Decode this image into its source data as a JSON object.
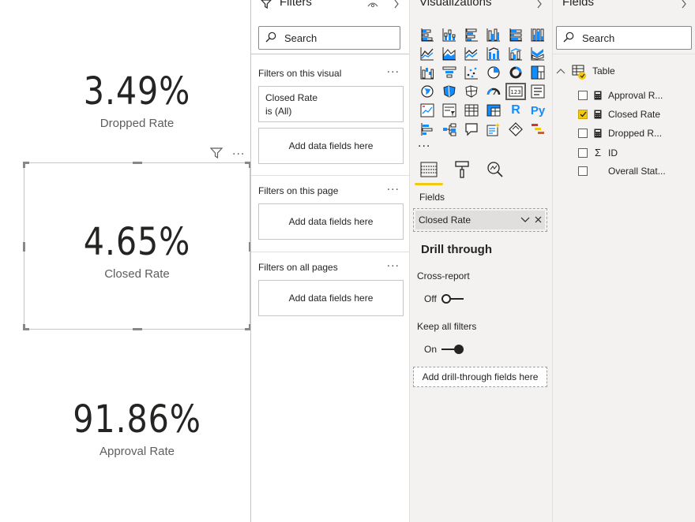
{
  "canvas": {
    "cards": [
      {
        "value": "3.49%",
        "label": "Dropped Rate"
      },
      {
        "value": "4.65%",
        "label": "Closed Rate"
      },
      {
        "value": "91.86%",
        "label": "Approval Rate"
      }
    ]
  },
  "filters": {
    "title": "Filters",
    "search_placeholder": "Search",
    "on_visual_label": "Filters on this visual",
    "visual_filter": {
      "field": "Closed Rate",
      "condition": "is (All)"
    },
    "add_fields": "Add data fields here",
    "on_page_label": "Filters on this page",
    "on_all_pages_label": "Filters on all pages"
  },
  "visualizations": {
    "title": "Visualizations",
    "more": "...",
    "fields_label": "Fields",
    "field_pill": "Closed Rate",
    "drill_title": "Drill through",
    "cross_report_label": "Cross-report",
    "cross_report_state": "Off",
    "keep_filters_label": "Keep all filters",
    "keep_filters_state": "On",
    "drill_drop": "Add drill-through fields here"
  },
  "fields": {
    "title": "Fields",
    "search_placeholder": "Search",
    "table_name": "Table",
    "items": [
      {
        "name": "Approval R...",
        "checked": false,
        "icon": "calculator-icon"
      },
      {
        "name": "Closed Rate",
        "checked": true,
        "icon": "calculator-icon"
      },
      {
        "name": "Dropped R...",
        "checked": false,
        "icon": "calculator-icon"
      },
      {
        "name": "ID",
        "checked": false,
        "icon": "sigma-icon"
      },
      {
        "name": "Overall Stat...",
        "checked": false,
        "icon": "none"
      }
    ]
  },
  "colors": {
    "accent": "#f2c811",
    "pane_bg": "#f3f2f1",
    "text": "#252423",
    "subtext": "#605e5c"
  }
}
